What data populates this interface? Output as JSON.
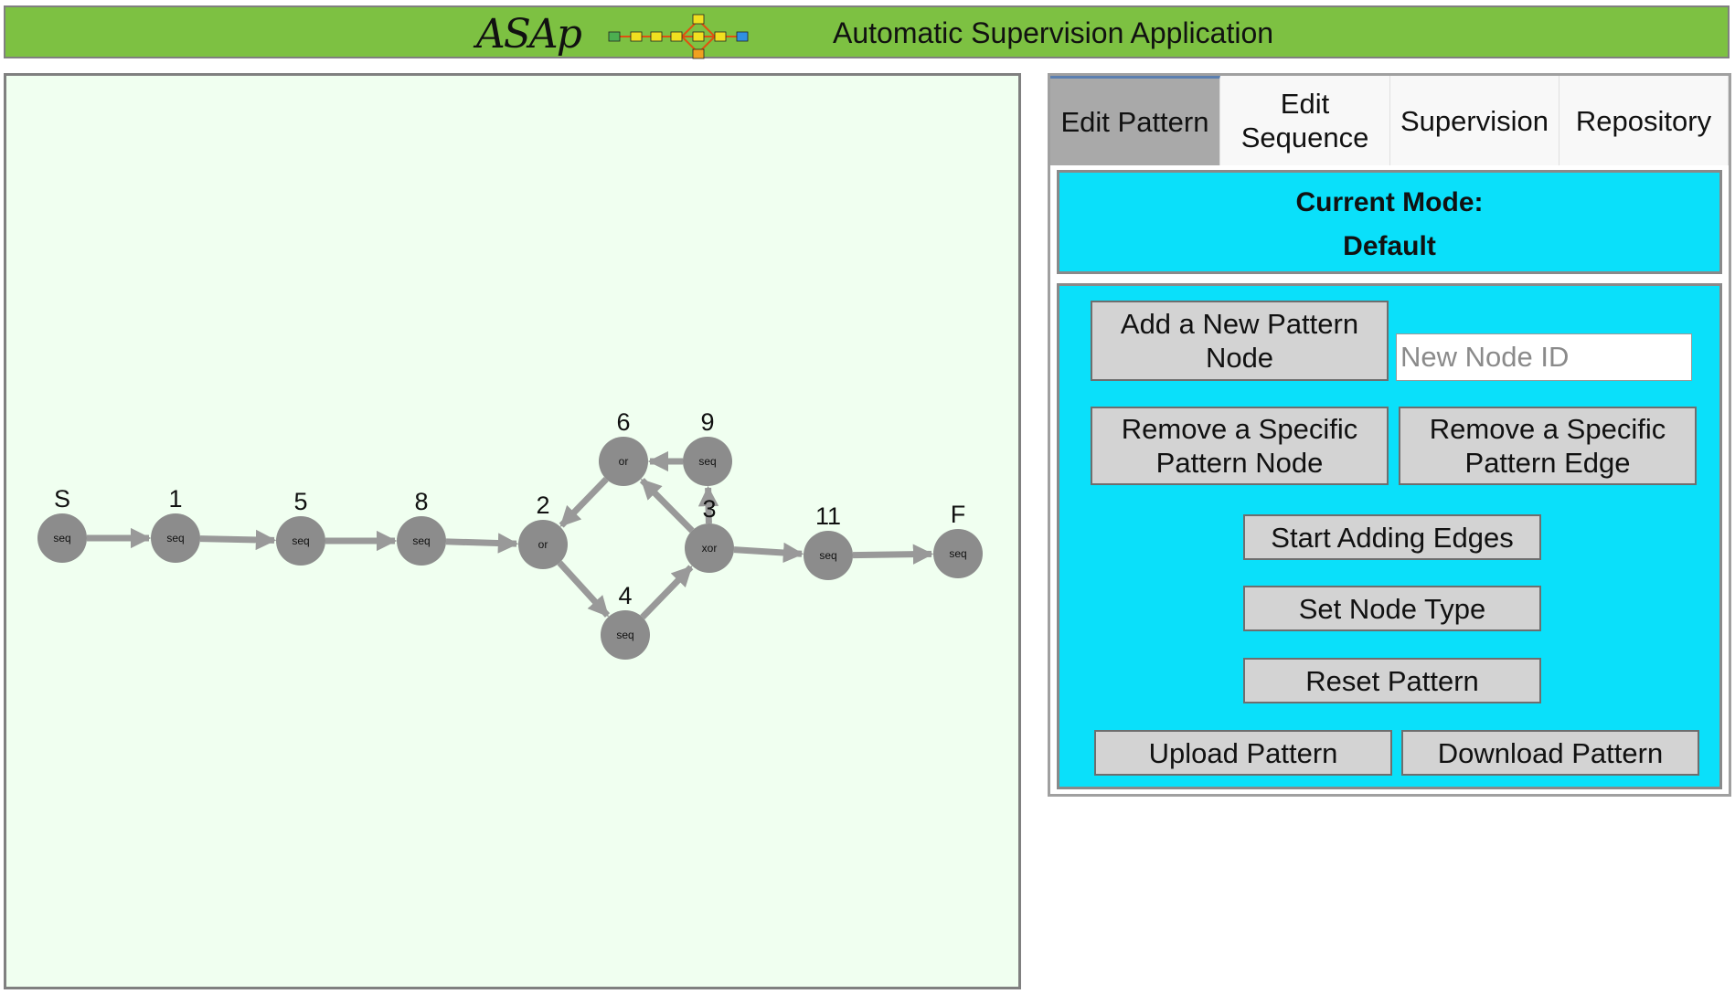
{
  "header": {
    "logo_text": "ASAp",
    "title": "Automatic Supervision Application",
    "background": "#7dc142"
  },
  "tabs": [
    {
      "label": "Edit Pattern",
      "active": true
    },
    {
      "label": "Edit\nSequence",
      "active": false
    },
    {
      "label": "Supervision",
      "active": false
    },
    {
      "label": "Repository",
      "active": false
    }
  ],
  "mode": {
    "label": "Current Mode:",
    "value": "Default",
    "background": "#0ae0fa"
  },
  "controls": {
    "add_node": "Add a New Pattern Node",
    "node_id_placeholder": "New Node ID",
    "remove_node": "Remove a Specific Pattern Node",
    "remove_edge": "Remove a Specific Pattern Edge",
    "start_edges": "Start Adding Edges",
    "set_type": "Set Node Type",
    "reset": "Reset Pattern",
    "upload": "Upload Pattern",
    "download": "Download Pattern"
  },
  "graph": {
    "node_color": "#8c8c8c",
    "edge_color": "#999999",
    "background": "#f0fff0",
    "nodes": [
      {
        "id": "S",
        "type": "seq"
      },
      {
        "id": "1",
        "type": "seq"
      },
      {
        "id": "5",
        "type": "seq"
      },
      {
        "id": "8",
        "type": "seq"
      },
      {
        "id": "2",
        "type": "or"
      },
      {
        "id": "6",
        "type": "or"
      },
      {
        "id": "9",
        "type": "seq"
      },
      {
        "id": "4",
        "type": "seq"
      },
      {
        "id": "3",
        "type": "xor"
      },
      {
        "id": "11",
        "type": "seq"
      },
      {
        "id": "F",
        "type": "seq"
      }
    ],
    "edges": [
      [
        "S",
        "1"
      ],
      [
        "1",
        "5"
      ],
      [
        "5",
        "8"
      ],
      [
        "8",
        "2"
      ],
      [
        "2",
        "4"
      ],
      [
        "4",
        "3"
      ],
      [
        "3",
        "6"
      ],
      [
        "3",
        "9"
      ],
      [
        "9",
        "6"
      ],
      [
        "6",
        "2"
      ],
      [
        "3",
        "11"
      ],
      [
        "11",
        "F"
      ]
    ]
  }
}
